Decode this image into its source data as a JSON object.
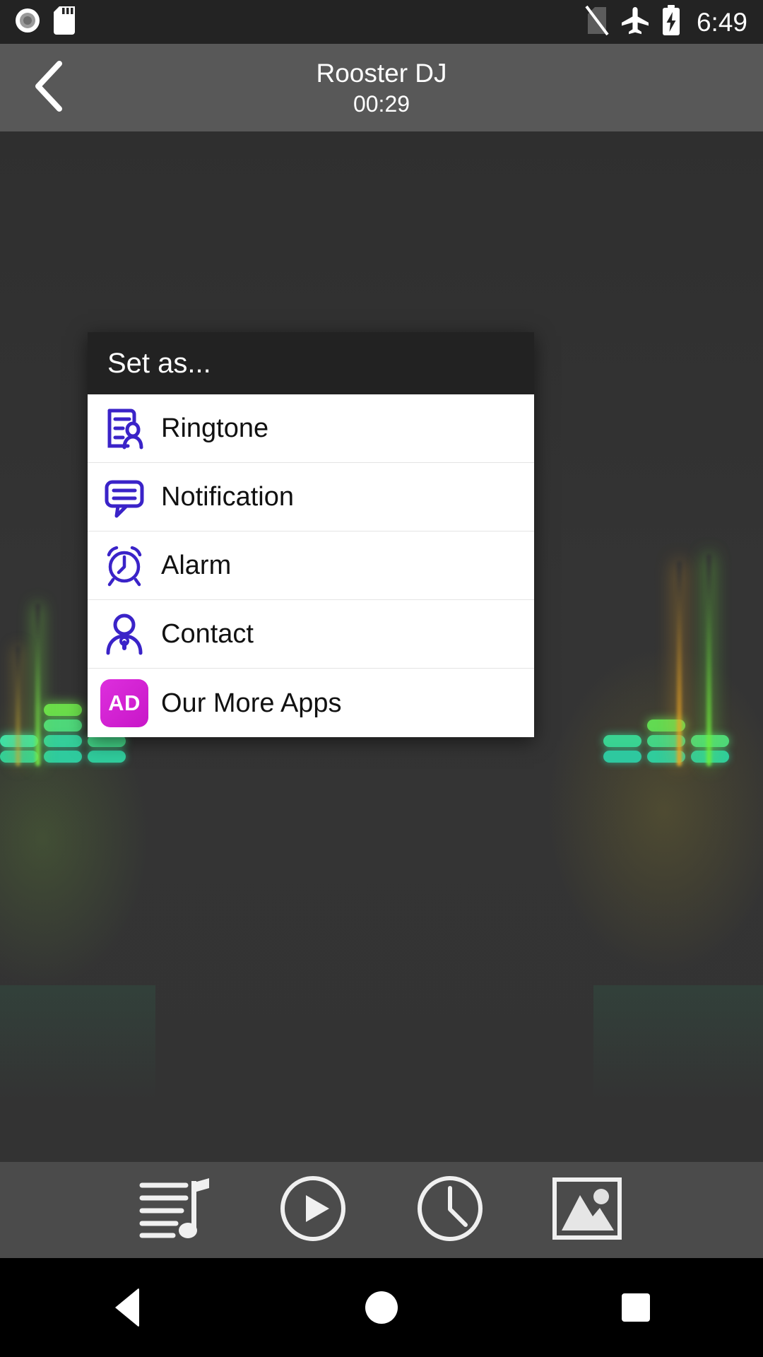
{
  "status_bar": {
    "icons_left": [
      "record-disc-icon",
      "sd-card-icon"
    ],
    "icons_right": [
      "no-sim-icon",
      "airplane-mode-icon",
      "battery-charging-icon"
    ],
    "time": "6:49"
  },
  "title_bar": {
    "back_icon": "chevron-left-icon",
    "title": "Rooster DJ",
    "time": "00:29"
  },
  "dialog": {
    "title": "Set as...",
    "items": [
      {
        "label": "Ringtone",
        "icon": "ringtone-contact-card-icon"
      },
      {
        "label": "Notification",
        "icon": "speech-bubble-icon"
      },
      {
        "label": "Alarm",
        "icon": "alarm-clock-icon"
      },
      {
        "label": "Contact",
        "icon": "person-icon"
      },
      {
        "label": "Our More Apps",
        "icon": "ad-badge-icon",
        "badge_text": "AD"
      }
    ]
  },
  "toolbar": {
    "buttons": [
      {
        "name": "playlist-button",
        "icon": "playlist-music-icon"
      },
      {
        "name": "play-button",
        "icon": "play-circle-icon"
      },
      {
        "name": "timer-button",
        "icon": "clock-icon"
      },
      {
        "name": "gallery-button",
        "icon": "image-gallery-icon"
      }
    ]
  },
  "nav_bar": {
    "buttons": [
      {
        "name": "nav-back-button",
        "icon": "triangle-back-icon"
      },
      {
        "name": "nav-home-button",
        "icon": "circle-home-icon"
      },
      {
        "name": "nav-recents-button",
        "icon": "square-recents-icon"
      }
    ]
  },
  "colors": {
    "status_bar_bg": "#232323",
    "title_bar_bg": "#585858",
    "content_bg": "#333333",
    "dialog_header_bg": "#222222",
    "dialog_body_bg": "#ffffff",
    "icon_accent": "#3a23c8",
    "ad_badge_bg": "#d41cd4",
    "toolbar_bg": "#4b4b4b",
    "nav_bar_bg": "#000000",
    "visualizer_green": "#2ecc8f",
    "visualizer_orange": "#e8a020"
  }
}
